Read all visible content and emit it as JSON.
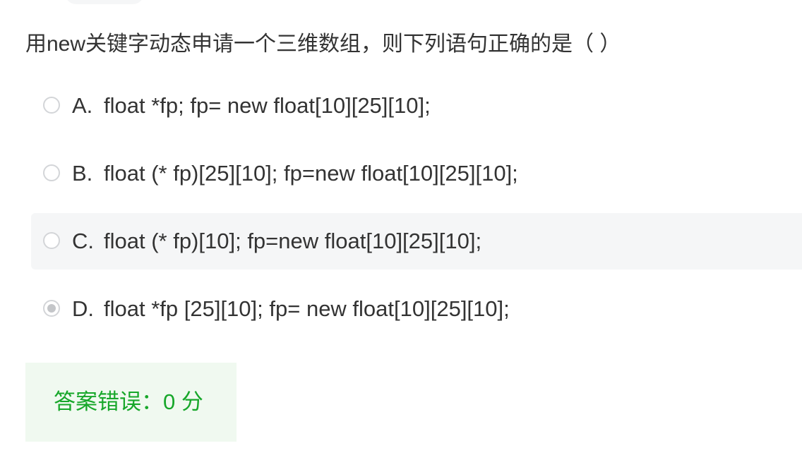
{
  "question": {
    "text": "用new关键字动态申请一个三维数组，则下列语句正确的是（ ）"
  },
  "options": [
    {
      "letter": "A.",
      "text": "float *fp; fp= new float[10][25][10];",
      "selected": false
    },
    {
      "letter": "B.",
      "text": "float (* fp)[25][10]; fp=new float[10][25][10];",
      "selected": false
    },
    {
      "letter": "C.",
      "text": "float (* fp)[10]; fp=new float[10][25][10];",
      "selected": false
    },
    {
      "letter": "D.",
      "text": "float *fp [25][10]; fp= new float[10][25][10];",
      "selected": true
    }
  ],
  "result": {
    "text": "答案错误：0 分"
  },
  "colors": {
    "result_text": "#17a72a",
    "result_bg": "#f0f9f0",
    "hover_bg": "#f5f6f7"
  }
}
